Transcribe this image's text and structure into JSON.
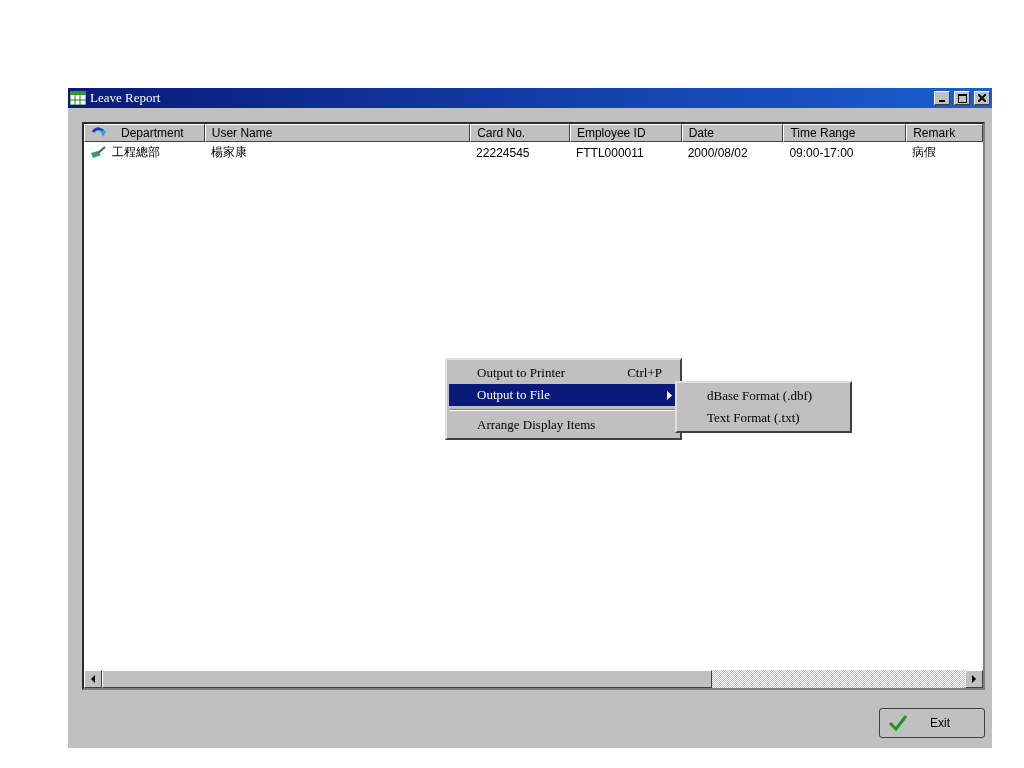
{
  "window": {
    "title": "Leave Report"
  },
  "table": {
    "columns": [
      "Department",
      "User Name",
      "Card No.",
      "Employee ID",
      "Date",
      "Time Range",
      "Remark"
    ],
    "rows": [
      {
        "cells": [
          "工程總部",
          "楊家康",
          "22224545",
          "FTTL000011",
          "2000/08/02",
          "09:00-17:00",
          "病假"
        ]
      }
    ]
  },
  "context_menu": {
    "items": [
      {
        "kind": "item",
        "label": "Output to Printer",
        "shortcut": "Ctrl+P",
        "selected": false,
        "has_submenu": false
      },
      {
        "kind": "item",
        "label": "Output to File",
        "selected": true,
        "has_submenu": true
      },
      {
        "kind": "separator"
      },
      {
        "kind": "item",
        "label": "Arrange Display Items",
        "selected": false,
        "has_submenu": false
      }
    ],
    "submenu": [
      {
        "label": "dBase Format (.dbf)",
        "selected": false
      },
      {
        "label": "Text Format (.txt)",
        "selected": false
      }
    ]
  },
  "buttons": [
    {
      "label": "Exit"
    }
  ]
}
